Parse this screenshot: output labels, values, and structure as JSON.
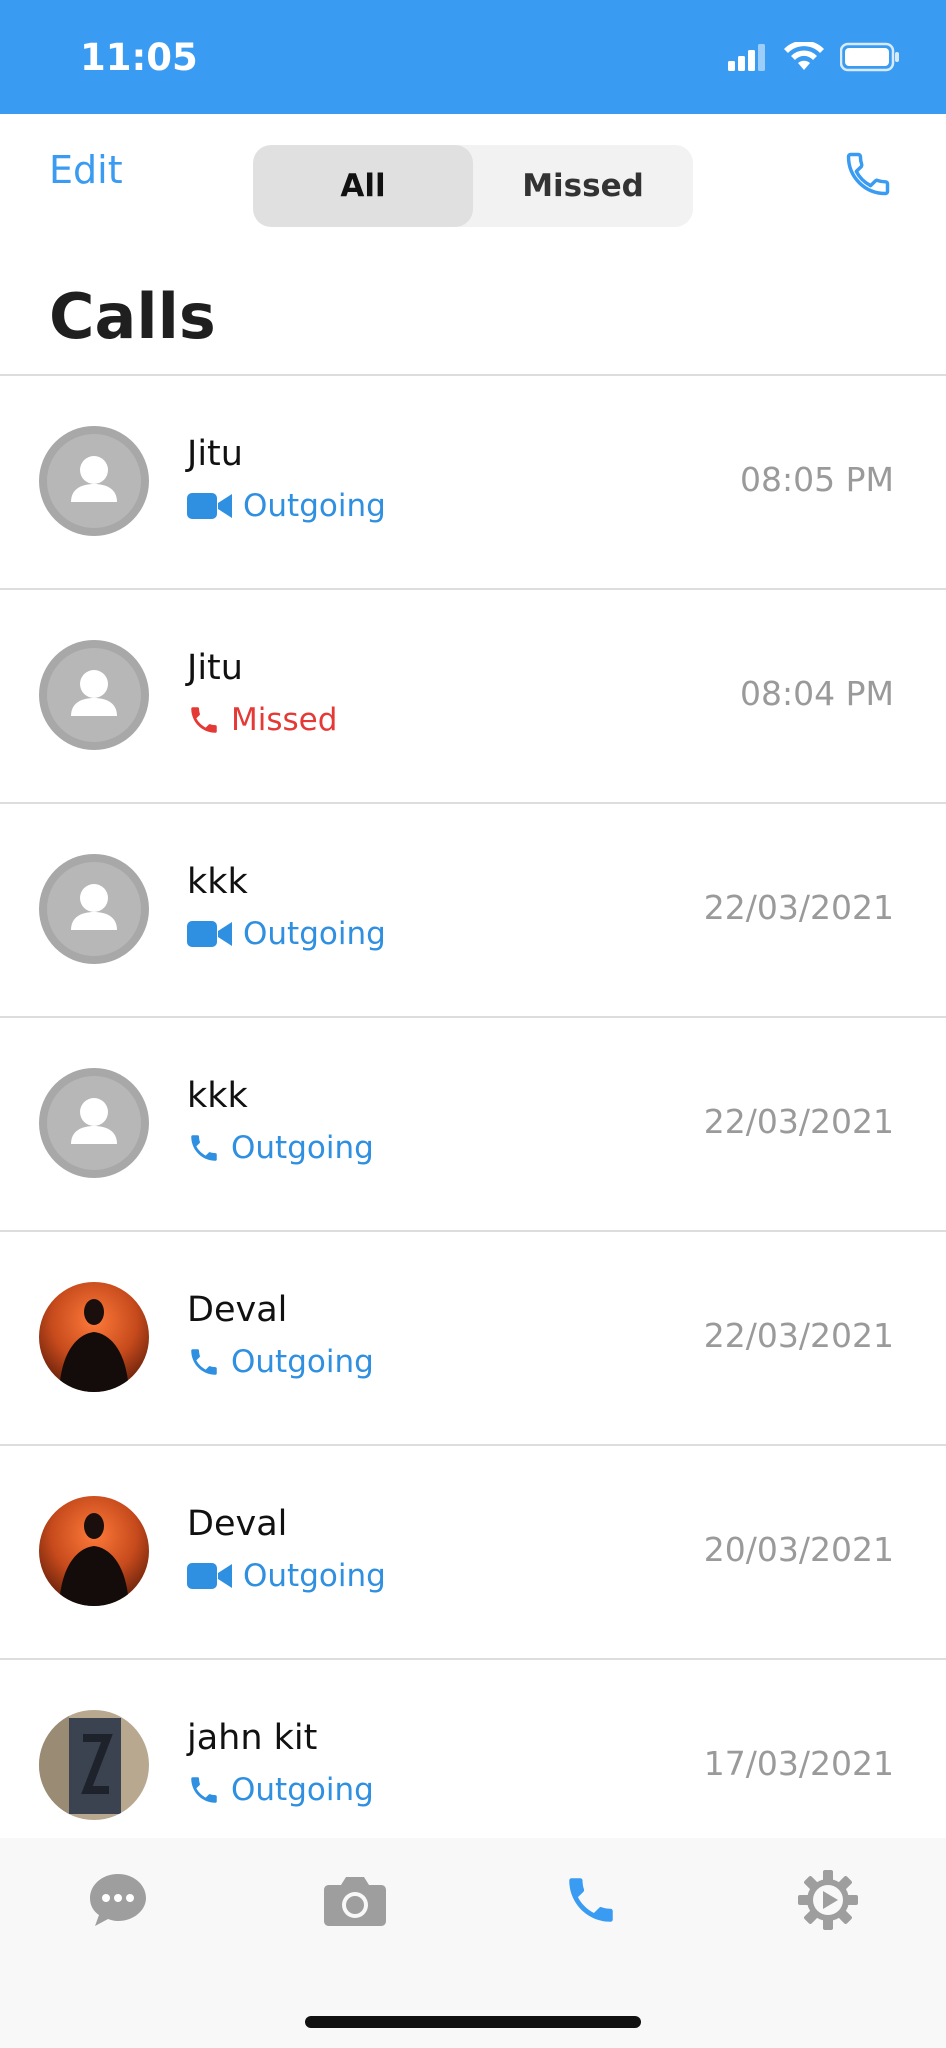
{
  "status": {
    "time": "11:05"
  },
  "header": {
    "edit_label": "Edit",
    "segments": [
      "All",
      "Missed"
    ],
    "active_segment": "All",
    "title": "Calls"
  },
  "calls": [
    {
      "name": "Jitu",
      "type_icon": "video-icon",
      "type_label": "Outgoing",
      "status": "outgoing",
      "time": "08:05 PM",
      "avatar": "default"
    },
    {
      "name": "Jitu",
      "type_icon": "phone-icon",
      "type_label": "Missed",
      "status": "missed",
      "time": "08:04 PM",
      "avatar": "default"
    },
    {
      "name": "kkk",
      "type_icon": "video-icon",
      "type_label": "Outgoing",
      "status": "outgoing",
      "time": "22/03/2021",
      "avatar": "default"
    },
    {
      "name": "kkk",
      "type_icon": "phone-icon",
      "type_label": "Outgoing",
      "status": "outgoing",
      "time": "22/03/2021",
      "avatar": "default"
    },
    {
      "name": "Deval",
      "type_icon": "phone-icon",
      "type_label": "Outgoing",
      "status": "outgoing",
      "time": "22/03/2021",
      "avatar": "photo-orange"
    },
    {
      "name": "Deval",
      "type_icon": "video-icon",
      "type_label": "Outgoing",
      "status": "outgoing",
      "time": "20/03/2021",
      "avatar": "photo-orange"
    },
    {
      "name": "jahn kit",
      "type_icon": "phone-icon",
      "type_label": "Outgoing",
      "status": "outgoing",
      "time": "17/03/2021",
      "avatar": "photo-box"
    }
  ],
  "tabbar": {
    "tabs": [
      "chats-icon",
      "camera-icon",
      "calls-icon",
      "settings-icon"
    ],
    "active": "calls-icon"
  },
  "colors": {
    "accent": "#3a9bf2",
    "missed": "#e53935",
    "muted": "#9a9a9a"
  }
}
